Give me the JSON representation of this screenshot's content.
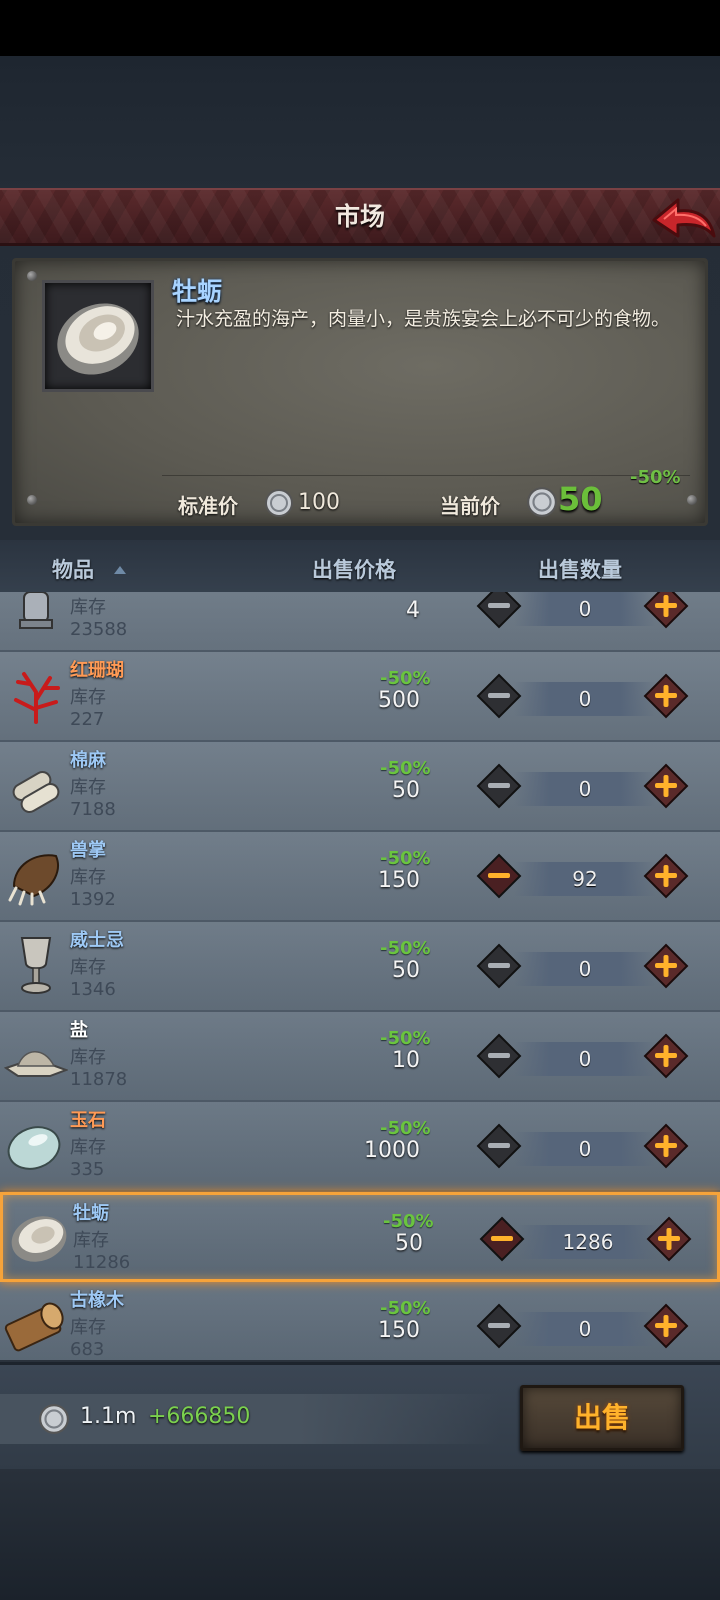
{
  "window": {
    "title": "市场"
  },
  "info": {
    "name": "牡蛎",
    "description": "汁水充盈的海产，肉量小，是贵族宴会上必不可少的食物。",
    "discount": "-50%",
    "standard_price_label": "标准价",
    "standard_price": "100",
    "current_price_label": "当前价",
    "current_price": "50",
    "image": "oyster-icon"
  },
  "table": {
    "col_item": "物品",
    "col_price": "出售价格",
    "col_quantity": "出售数量"
  },
  "items": [
    {
      "name": "",
      "stock_label": "库存",
      "stock": "23588",
      "price": "4",
      "discount": "",
      "quantity": "0",
      "icon": "lantern-icon",
      "selected": false
    },
    {
      "name": "红珊瑚",
      "name_color": "#ff9a55",
      "stock_label": "库存",
      "stock": "227",
      "price": "500",
      "discount": "-50%",
      "quantity": "0",
      "icon": "red-coral-icon",
      "selected": false
    },
    {
      "name": "棉麻",
      "name_color": "#9ec9f5",
      "stock_label": "库存",
      "stock": "7188",
      "price": "50",
      "discount": "-50%",
      "quantity": "0",
      "icon": "cloth-roll-icon",
      "selected": false
    },
    {
      "name": "兽掌",
      "name_color": "#9ec9f5",
      "stock_label": "库存",
      "stock": "1392",
      "price": "150",
      "discount": "-50%",
      "quantity": "92",
      "icon": "beast-paw-icon",
      "selected": false
    },
    {
      "name": "威士忌",
      "name_color": "#9ec9f5",
      "stock_label": "库存",
      "stock": "1346",
      "price": "50",
      "discount": "-50%",
      "quantity": "0",
      "icon": "goblet-icon",
      "selected": false
    },
    {
      "name": "盐",
      "name_color": "#ffffff",
      "stock_label": "库存",
      "stock": "11878",
      "price": "10",
      "discount": "-50%",
      "quantity": "0",
      "icon": "salt-pile-icon",
      "selected": false
    },
    {
      "name": "玉石",
      "name_color": "#ff9a55",
      "stock_label": "库存",
      "stock": "335",
      "price": "1000",
      "discount": "-50%",
      "quantity": "0",
      "icon": "jade-stone-icon",
      "selected": false
    },
    {
      "name": "牡蛎",
      "name_color": "#9ec9f5",
      "stock_label": "库存",
      "stock": "11286",
      "price": "50",
      "discount": "-50%",
      "quantity": "1286",
      "icon": "oyster-icon",
      "selected": true
    },
    {
      "name": "古橡木",
      "name_color": "#9ec9f5",
      "stock_label": "库存",
      "stock": "683",
      "price": "150",
      "discount": "-50%",
      "quantity": "0",
      "icon": "oak-log-icon",
      "selected": false
    }
  ],
  "footer": {
    "balance": "1.1m",
    "balance_change": "+666850",
    "sell_label": "出售"
  },
  "colors": {
    "accent_orange": "#ffb22b",
    "discount_green": "#6ac43f",
    "selected_border": "#f6a33a",
    "title_bar": "#4e2326"
  }
}
